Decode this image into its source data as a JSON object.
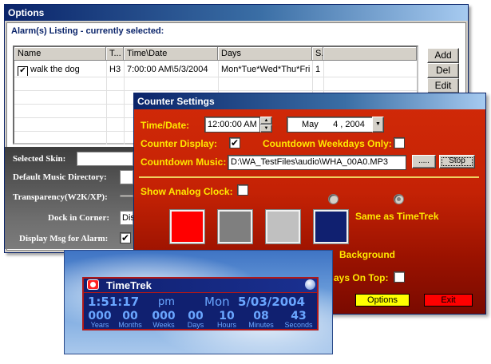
{
  "options": {
    "title": "Options",
    "alarm_listing_title": "Alarm(s) Listing - currently selected:",
    "columns": [
      "Name",
      "T...",
      "Time\\Date",
      "Days",
      "S..."
    ],
    "rows": [
      {
        "checked": true,
        "name": "walk the dog",
        "type": "H3",
        "time_date": "7:00:00 AM\\5/3/2004",
        "days": "Mon*Tue*Wed*Thu*Fri",
        "s": "1"
      }
    ],
    "buttons": {
      "add": "Add",
      "del": "Del",
      "edit": "Edit"
    },
    "selected_skin_label": "Selected Skin:",
    "default_music_dir_label": "Default Music Directory:",
    "transparency_label": "Transparency(W2K/XP):",
    "dock_label": "Dock in Corner:",
    "dock_value": "Dis",
    "display_msg_label": "Display Msg for Alarm:",
    "display_msg_checked": "✔"
  },
  "counter": {
    "title": "Counter Settings",
    "time_date_label": "Time/Date:",
    "time_value": "12:00:00 AM",
    "date_value": "May      4 , 2004",
    "counter_display_label": "Counter Display:",
    "counter_display_checked": "✔",
    "countdown_weekdays_label": "Countdown Weekdays Only:",
    "countdown_music_label": "Countdown Music:",
    "music_path": "D:\\WA_TestFiles\\audio\\WHA_00A0.MP3",
    "browse_label": ".....",
    "stop_label": "Stop",
    "show_analog_label": "Show Analog Clock:",
    "same_as_label": "Same as TimeTrek",
    "background_label": "Background",
    "always_on_top_label": "ays On Top:",
    "options_btn": "Options",
    "exit_btn": "Exit",
    "colors": {
      "swatch1": "#ff0000",
      "swatch2": "#7f7f7f",
      "swatch3": "#c0c0c0",
      "swatch4": "#102070",
      "yellow": "#ffe800"
    }
  },
  "timetrek": {
    "title": "TimeTrek",
    "time": "1:51:17",
    "ampm": "pm",
    "day": "Mon",
    "date": "5/03/2004",
    "counters": [
      {
        "value": "000",
        "unit": "Years"
      },
      {
        "value": "00",
        "unit": "Months"
      },
      {
        "value": "000",
        "unit": "Weeks"
      },
      {
        "value": "00",
        "unit": "Days"
      },
      {
        "value": "10",
        "unit": "Hours"
      },
      {
        "value": "08",
        "unit": "Minutes"
      },
      {
        "value": "43",
        "unit": "Seconds"
      }
    ]
  }
}
